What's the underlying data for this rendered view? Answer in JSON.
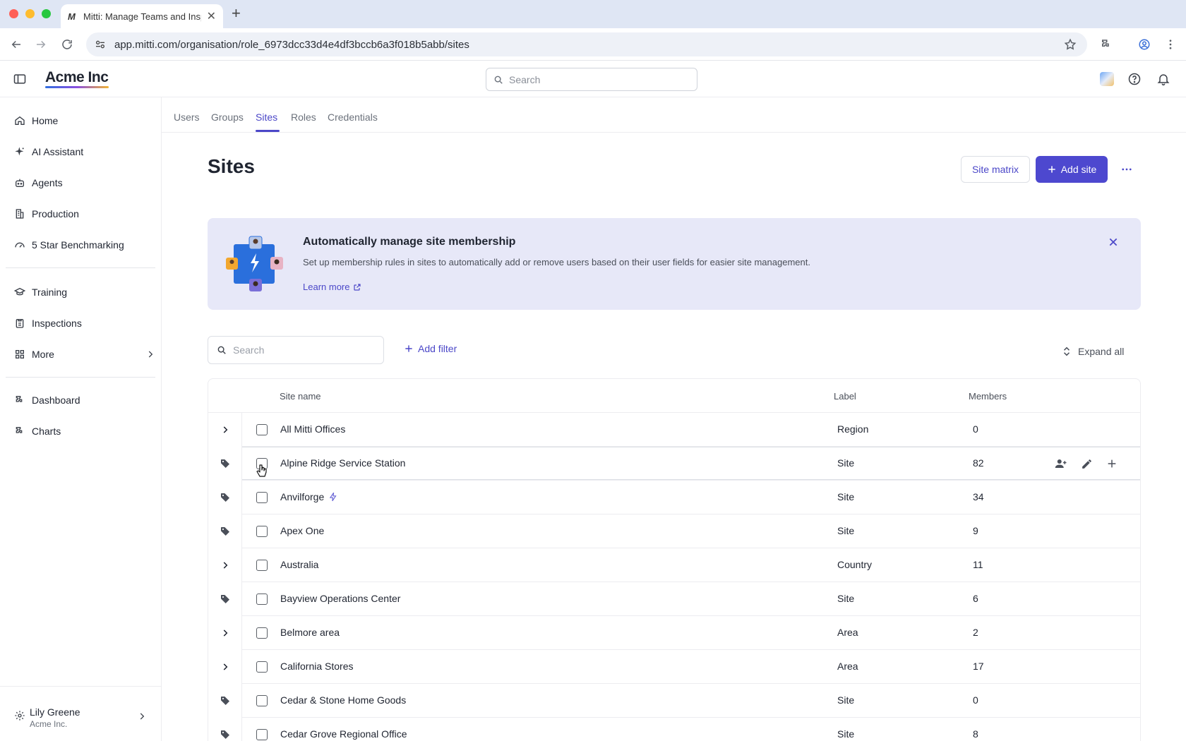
{
  "browser": {
    "tab_title": "Mitti: Manage Teams and Insp",
    "favicon": "M",
    "url": "app.mitti.com/organisation/role_6973dcc33d4e4df3bccb6a3f018b5abb/sites"
  },
  "header": {
    "brand": "Acme Inc",
    "search_placeholder": "Search"
  },
  "sidebar": {
    "items": [
      {
        "label": "Home",
        "icon": "home-icon"
      },
      {
        "label": "AI Assistant",
        "icon": "sparkle-icon"
      },
      {
        "label": "Agents",
        "icon": "robot-icon"
      },
      {
        "label": "Production",
        "icon": "building-icon"
      },
      {
        "label": "5 Star Benchmarking",
        "icon": "gauge-icon"
      },
      {
        "label": "Training",
        "icon": "graduation-cap-icon"
      },
      {
        "label": "Inspections",
        "icon": "clipboard-icon"
      },
      {
        "label": "More",
        "icon": "grid-icon"
      },
      {
        "label": "Dashboard",
        "icon": "puzzle-icon"
      },
      {
        "label": "Charts",
        "icon": "puzzle-icon"
      }
    ],
    "user": {
      "name": "Lily Greene",
      "org": "Acme Inc."
    }
  },
  "subtabs": [
    "Users",
    "Groups",
    "Sites",
    "Roles",
    "Credentials"
  ],
  "active_subtab": "Sites",
  "page": {
    "title": "Sites",
    "site_matrix_label": "Site matrix",
    "add_site_label": "Add site"
  },
  "banner": {
    "title": "Automatically manage site membership",
    "description": "Set up membership rules in sites to automatically add or remove users based on their user fields for easier site management.",
    "link": "Learn more"
  },
  "filters": {
    "search_placeholder": "Search",
    "add_filter_label": "Add filter",
    "expand_all_label": "Expand all"
  },
  "table": {
    "columns": {
      "name": "Site name",
      "label": "Label",
      "members": "Members"
    },
    "rows": [
      {
        "name": "All Mitti Offices",
        "label": "Region",
        "members": "0",
        "type": "group"
      },
      {
        "name": "Alpine Ridge Service Station",
        "label": "Site",
        "members": "82",
        "type": "site",
        "hover": true
      },
      {
        "name": "Anvilforge",
        "label": "Site",
        "members": "34",
        "type": "site",
        "rule": true
      },
      {
        "name": "Apex One",
        "label": "Site",
        "members": "9",
        "type": "site"
      },
      {
        "name": "Australia",
        "label": "Country",
        "members": "11",
        "type": "group"
      },
      {
        "name": "Bayview Operations Center",
        "label": "Site",
        "members": "6",
        "type": "site"
      },
      {
        "name": "Belmore area",
        "label": "Area",
        "members": "2",
        "type": "group"
      },
      {
        "name": "California Stores",
        "label": "Area",
        "members": "17",
        "type": "group"
      },
      {
        "name": "Cedar & Stone Home Goods",
        "label": "Site",
        "members": "0",
        "type": "site"
      },
      {
        "name": "Cedar Grove Regional Office",
        "label": "Site",
        "members": "8",
        "type": "site"
      }
    ]
  },
  "colors": {
    "accent": "#4d48cf",
    "banner_bg": "#e7e8f8"
  }
}
